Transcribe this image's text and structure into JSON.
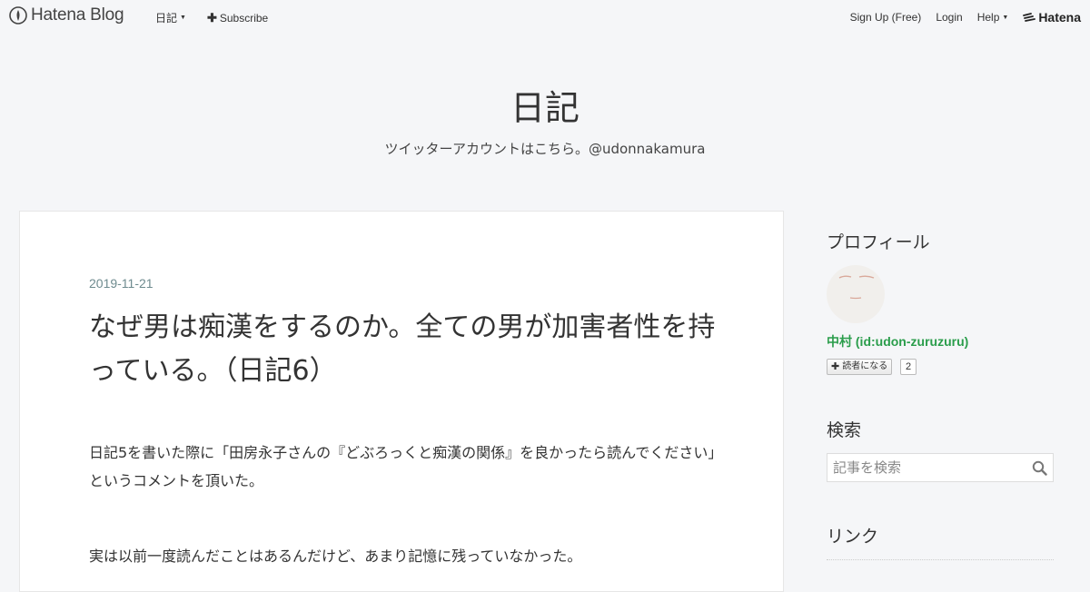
{
  "topbar": {
    "logo_text": "Hatena Blog",
    "blog_menu_label": "日記",
    "subscribe_label": "Subscribe",
    "signup_label": "Sign Up (Free)",
    "login_label": "Login",
    "help_label": "Help",
    "brand_label": "Hatena"
  },
  "blog": {
    "title": "日記",
    "description": "ツイッターアカウントはこちら。@udonnakamura"
  },
  "article": {
    "date": "2019-11-21",
    "title": "なぜ男は痴漢をするのか。全ての男が加害者性を持っている。（日記6）",
    "paragraphs": [
      "日記5を書いた際に「田房永子さんの『どぶろっくと痴漢の関係』を良かったら読んでください」というコメントを頂いた。",
      "実は以前一度読んだことはあるんだけど、あまり記憶に残っていなかった。"
    ]
  },
  "sidebar": {
    "profile_heading": "プロフィール",
    "profile_name": "中村 (id:udon-zuruzuru)",
    "subscribe_button": "読者になる",
    "subscriber_count": "2",
    "search_heading": "検索",
    "search_placeholder": "記事を検索",
    "links_heading": "リンク"
  },
  "colors": {
    "page_bg": "#f5f6f8",
    "date": "#6e8b8f",
    "profile_name": "#2a9d4b"
  },
  "icons": [
    "hatena-blog-logo-icon",
    "caret-down-icon",
    "plus-icon",
    "hatena-brand-icon",
    "search-icon"
  ]
}
